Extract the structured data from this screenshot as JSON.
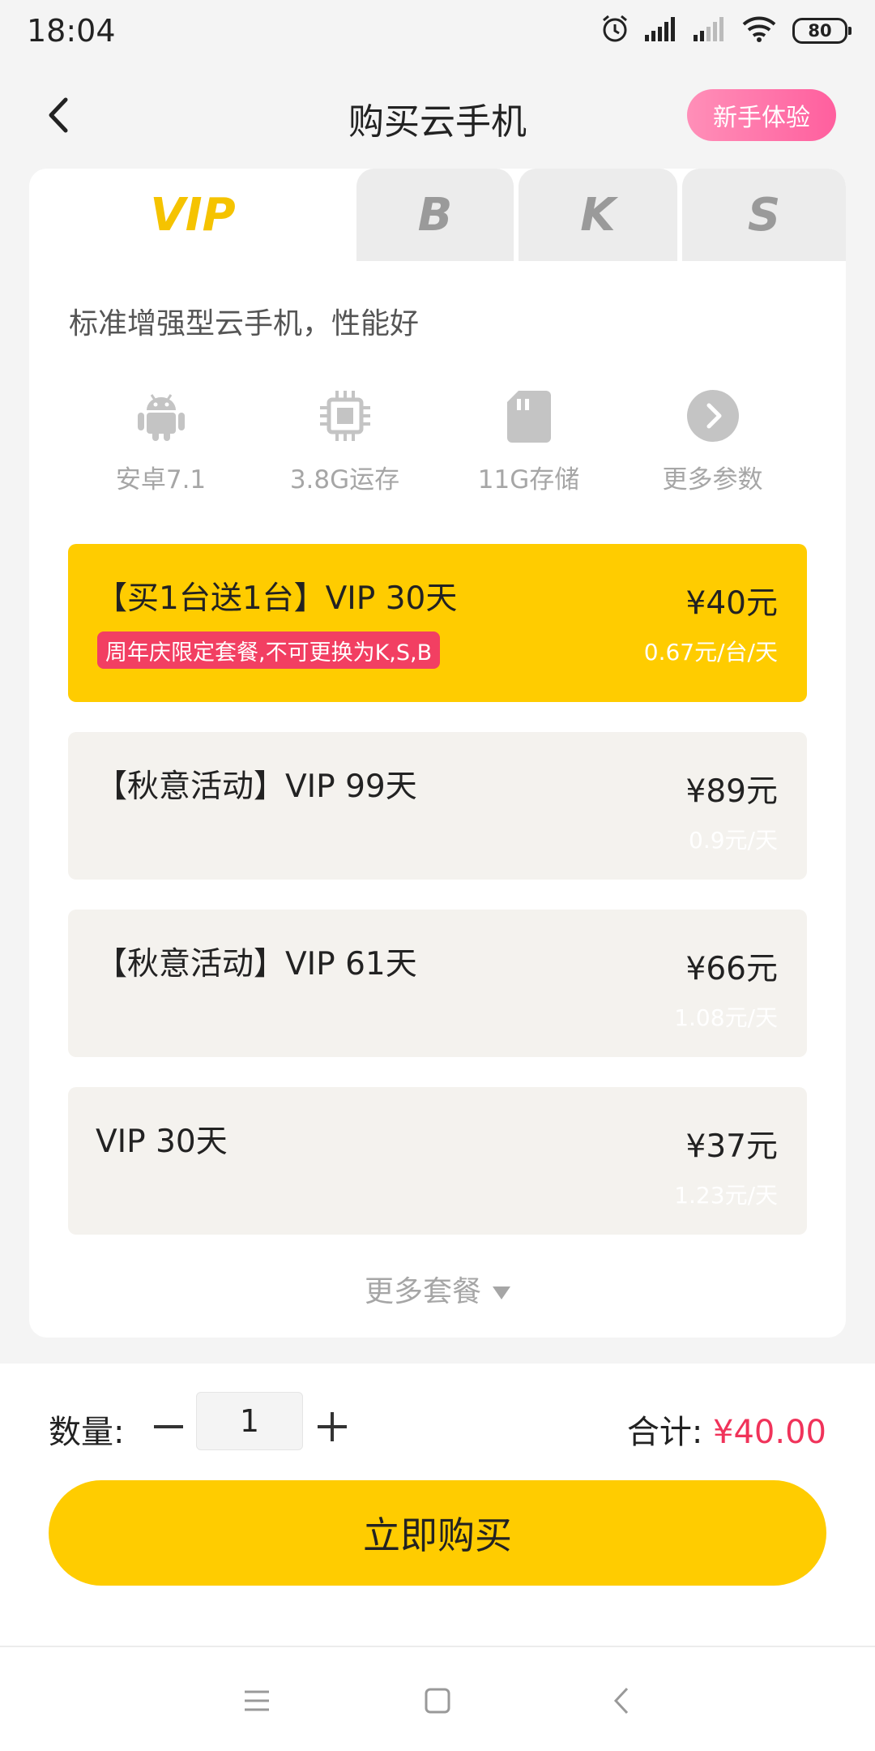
{
  "status": {
    "time": "18:04",
    "battery": "80"
  },
  "header": {
    "title": "购买云手机",
    "trial_label": "新手体验"
  },
  "tabs": [
    {
      "label": "VIP",
      "active": true
    },
    {
      "label": "B",
      "active": false
    },
    {
      "label": "K",
      "active": false
    },
    {
      "label": "S",
      "active": false
    }
  ],
  "description": "标准增强型云手机，性能好",
  "specs": [
    {
      "label": "安卓7.1",
      "icon": "android-icon"
    },
    {
      "label": "3.8G运存",
      "icon": "cpu-chip-icon"
    },
    {
      "label": "11G存储",
      "icon": "sd-card-icon"
    },
    {
      "label": "更多参数",
      "icon": "chevron-right-circle-icon"
    }
  ],
  "plans": [
    {
      "name": "【买1台送1台】VIP 30天",
      "price": "¥40元",
      "unit_price": "0.67元/台/天",
      "tag": "周年庆限定套餐,不可更换为K,S,B",
      "selected": true
    },
    {
      "name": "【秋意活动】VIP 99天",
      "price": "¥89元",
      "unit_price": "0.9元/天",
      "selected": false
    },
    {
      "name": "【秋意活动】VIP 61天",
      "price": "¥66元",
      "unit_price": "1.08元/天",
      "selected": false
    },
    {
      "name": "VIP 30天",
      "price": "¥37元",
      "unit_price": "1.23元/天",
      "selected": false
    }
  ],
  "more_plans_label": "更多套餐",
  "purchase": {
    "quantity_label": "数量:",
    "quantity_value": "1",
    "total_label": "合计:",
    "total_value": "¥40.00",
    "buy_label": "立即购买"
  },
  "colors": {
    "accent": "#ffcc00",
    "price_red": "#f0335a",
    "trial_pink": "#ff6fa6",
    "tag_red": "#f23f62"
  }
}
